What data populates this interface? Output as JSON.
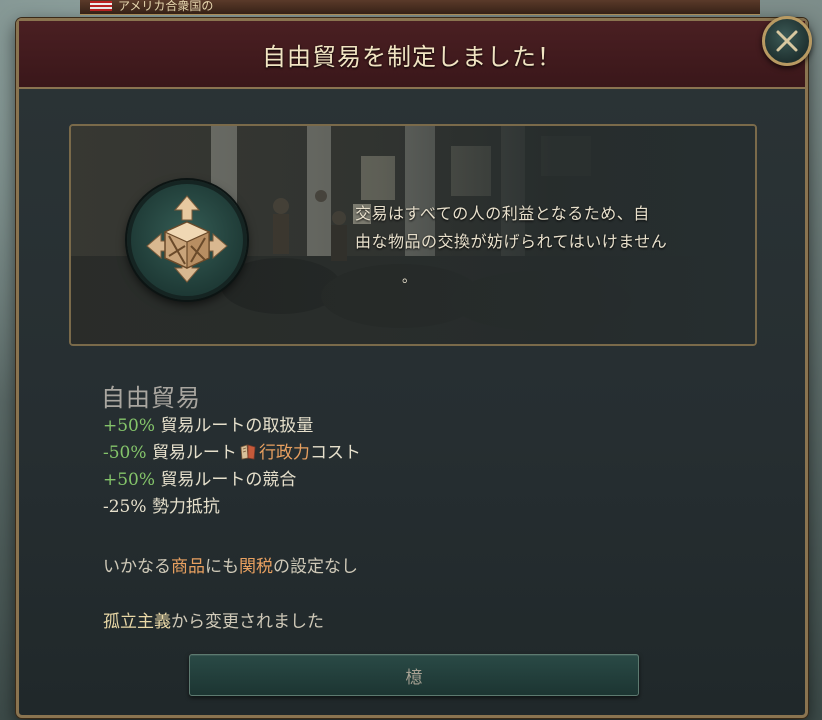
{
  "background": {
    "notification_text": "アメリカ合衆国の"
  },
  "dialog": {
    "title": "自由貿易を制定しました！",
    "close_icon": "close-x-icon",
    "quote_line1": "交易はすべての人の利益となるため、自",
    "quote_line2": "由な物品の交換が妨げられてはいけません",
    "quote_end": "。",
    "emblem_icon": "trade-crate-icon",
    "policy_name": "自由貿易",
    "effects": [
      {
        "value": "+50%",
        "text": "貿易ルートの取扱量"
      },
      {
        "value": "-50%",
        "text_before": "貿易ルート",
        "icon": "admin-scroll-icon",
        "highlight": "行政力",
        "text_after": "コスト"
      },
      {
        "value": "+50%",
        "text": "貿易ルートの競合"
      },
      {
        "value": "-25%",
        "text": "勢力抵抗"
      }
    ],
    "note": {
      "part1": "いかなる",
      "goods": "商品",
      "part2": "にも",
      "tariff": "関税",
      "part3": "の設定なし"
    },
    "changed_from": {
      "law": "孤立主義",
      "suffix": "から変更されました"
    },
    "ok_label": "檍"
  },
  "colors": {
    "positive": "#84c46a",
    "highlight": "#e8a060",
    "header": "#4a1f22",
    "border_gold": "#8a7450"
  }
}
